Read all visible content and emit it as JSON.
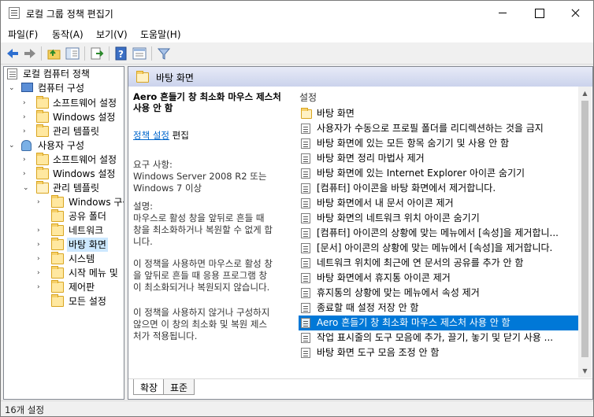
{
  "window": {
    "title": "로컬 그룹 정책 편집기"
  },
  "menubar": [
    "파일(F)",
    "동작(A)",
    "보기(V)",
    "도움말(H)"
  ],
  "toolbar": {
    "buttons": [
      "back-arrow-icon",
      "forward-arrow-icon",
      "up-folder-icon",
      "show-tree-icon",
      "export-list-icon",
      "help-icon",
      "properties-icon",
      "filter-icon"
    ]
  },
  "tree": {
    "root": "로컬 컴퓨터 정책",
    "items": [
      {
        "label": "컴퓨터 구성"
      },
      {
        "label": "소프트웨어 설정"
      },
      {
        "label": "Windows 설정"
      },
      {
        "label": "관리 템플릿"
      },
      {
        "label": "사용자 구성"
      },
      {
        "label": "소프트웨어 설정"
      },
      {
        "label": "Windows 설정"
      },
      {
        "label": "관리 템플릿"
      },
      {
        "label": "Windows 구성"
      },
      {
        "label": "공유 폴더"
      },
      {
        "label": "네트워크"
      },
      {
        "label": "바탕 화면"
      },
      {
        "label": "시스템"
      },
      {
        "label": "시작 메뉴 및"
      },
      {
        "label": "제어판"
      },
      {
        "label": "모든 설정"
      }
    ]
  },
  "header": {
    "title": "바탕 화면"
  },
  "description": {
    "title": "Aero 흔들기 창 최소화 마우스 제스처 사용 안 함",
    "link": "정책 설정",
    "link_suffix": "편집",
    "requirements": "요구 사항:\nWindows Server 2008 R2 또는\nWindows 7 이상",
    "desc": "설명:\n마우스로 활성 창을 앞뒤로 흔들 때\n창을 최소화하거나 복원할 수 없게 합\n니다.",
    "p2": "이 정책을 사용하면 마우스로 활성 창\n을 앞뒤로 흔들 때 응용 프로그램 창\n이 최소화되거나 복원되지 않습니다.",
    "p3": "이 정책을 사용하지 않거나 구성하지\n않으면 이 창의 최소화 및 복원 제스\n처가 적용됩니다."
  },
  "list": {
    "header": "설정",
    "items": [
      {
        "label": "바탕 화면",
        "type": "folder"
      },
      {
        "label": "사용자가 수동으로 프로필 폴더를 리디렉션하는 것을 금지",
        "type": "setting"
      },
      {
        "label": "바탕 화면에 있는 모든 항목 숨기기 및 사용 안 함",
        "type": "setting"
      },
      {
        "label": "바탕 화면 정리 마법사 제거",
        "type": "setting"
      },
      {
        "label": "바탕 화면에 있는 Internet Explorer 아이콘 숨기기",
        "type": "setting"
      },
      {
        "label": "[컴퓨터] 아이콘을 바탕 화면에서 제거합니다.",
        "type": "setting"
      },
      {
        "label": "바탕 화면에서 내 문서 아이콘 제거",
        "type": "setting"
      },
      {
        "label": "바탕 화면의 네트워크 위치 아이콘 숨기기",
        "type": "setting"
      },
      {
        "label": "[컴퓨터] 아이콘의 상황에 맞는 메뉴에서 [속성]을 제거합니...",
        "type": "setting"
      },
      {
        "label": "[문서] 아이콘의 상황에 맞는 메뉴에서 [속성]을 제거합니다.",
        "type": "setting"
      },
      {
        "label": "네트워크 위치에 최근에 연 문서의 공유를 추가 안 함",
        "type": "setting"
      },
      {
        "label": "바탕 화면에서 휴지통 아이콘 제거",
        "type": "setting"
      },
      {
        "label": "휴지통의 상황에 맞는 메뉴에서 속성 제거",
        "type": "setting"
      },
      {
        "label": "종료할 때 설정 저장 안 함",
        "type": "setting"
      },
      {
        "label": "Aero 흔들기 창 최소화 마우스 제스처 사용 안 함",
        "type": "setting",
        "selected": true
      },
      {
        "label": "작업 표시줄의 도구 모음에 추가, 끌기, 놓기 및 닫기 사용 ...",
        "type": "setting"
      },
      {
        "label": "바탕 화면 도구 모음 조정 안 함",
        "type": "setting"
      }
    ]
  },
  "tabs": [
    "확장",
    "표준"
  ],
  "status": {
    "text": "16개 설정"
  }
}
